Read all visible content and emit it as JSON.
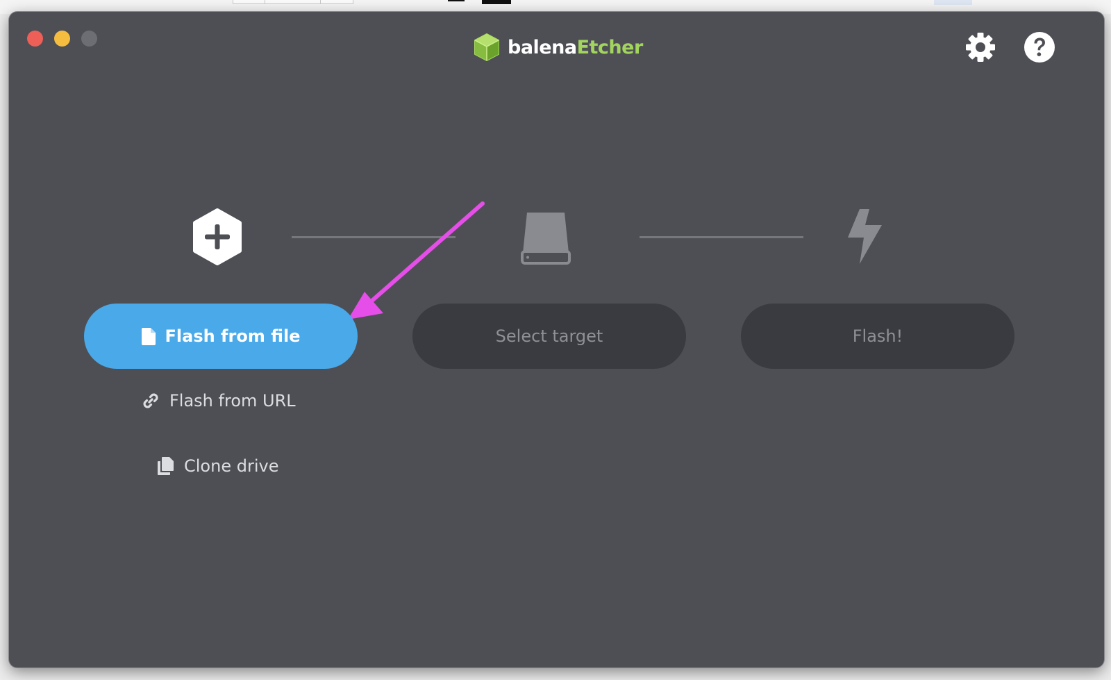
{
  "app": {
    "brand_prefix": "balena",
    "brand_suffix": "Etcher"
  },
  "colors": {
    "window_bg": "#4e4f55",
    "primary": "#4aa9e9",
    "brand_green": "#a2d45e",
    "disabled_bg": "#3a3b40",
    "annotation": "#e54ee8"
  },
  "icons": {
    "settings": "gear-icon",
    "help": "question-icon",
    "step_source": "plus-hexagon-icon",
    "step_target": "drive-icon",
    "step_flash": "lightning-icon"
  },
  "steps": {
    "source": {
      "primary_label": "Flash from file",
      "url_label": "Flash from URL",
      "clone_label": "Clone drive"
    },
    "target": {
      "label": "Select target"
    },
    "flash": {
      "label": "Flash!"
    }
  }
}
